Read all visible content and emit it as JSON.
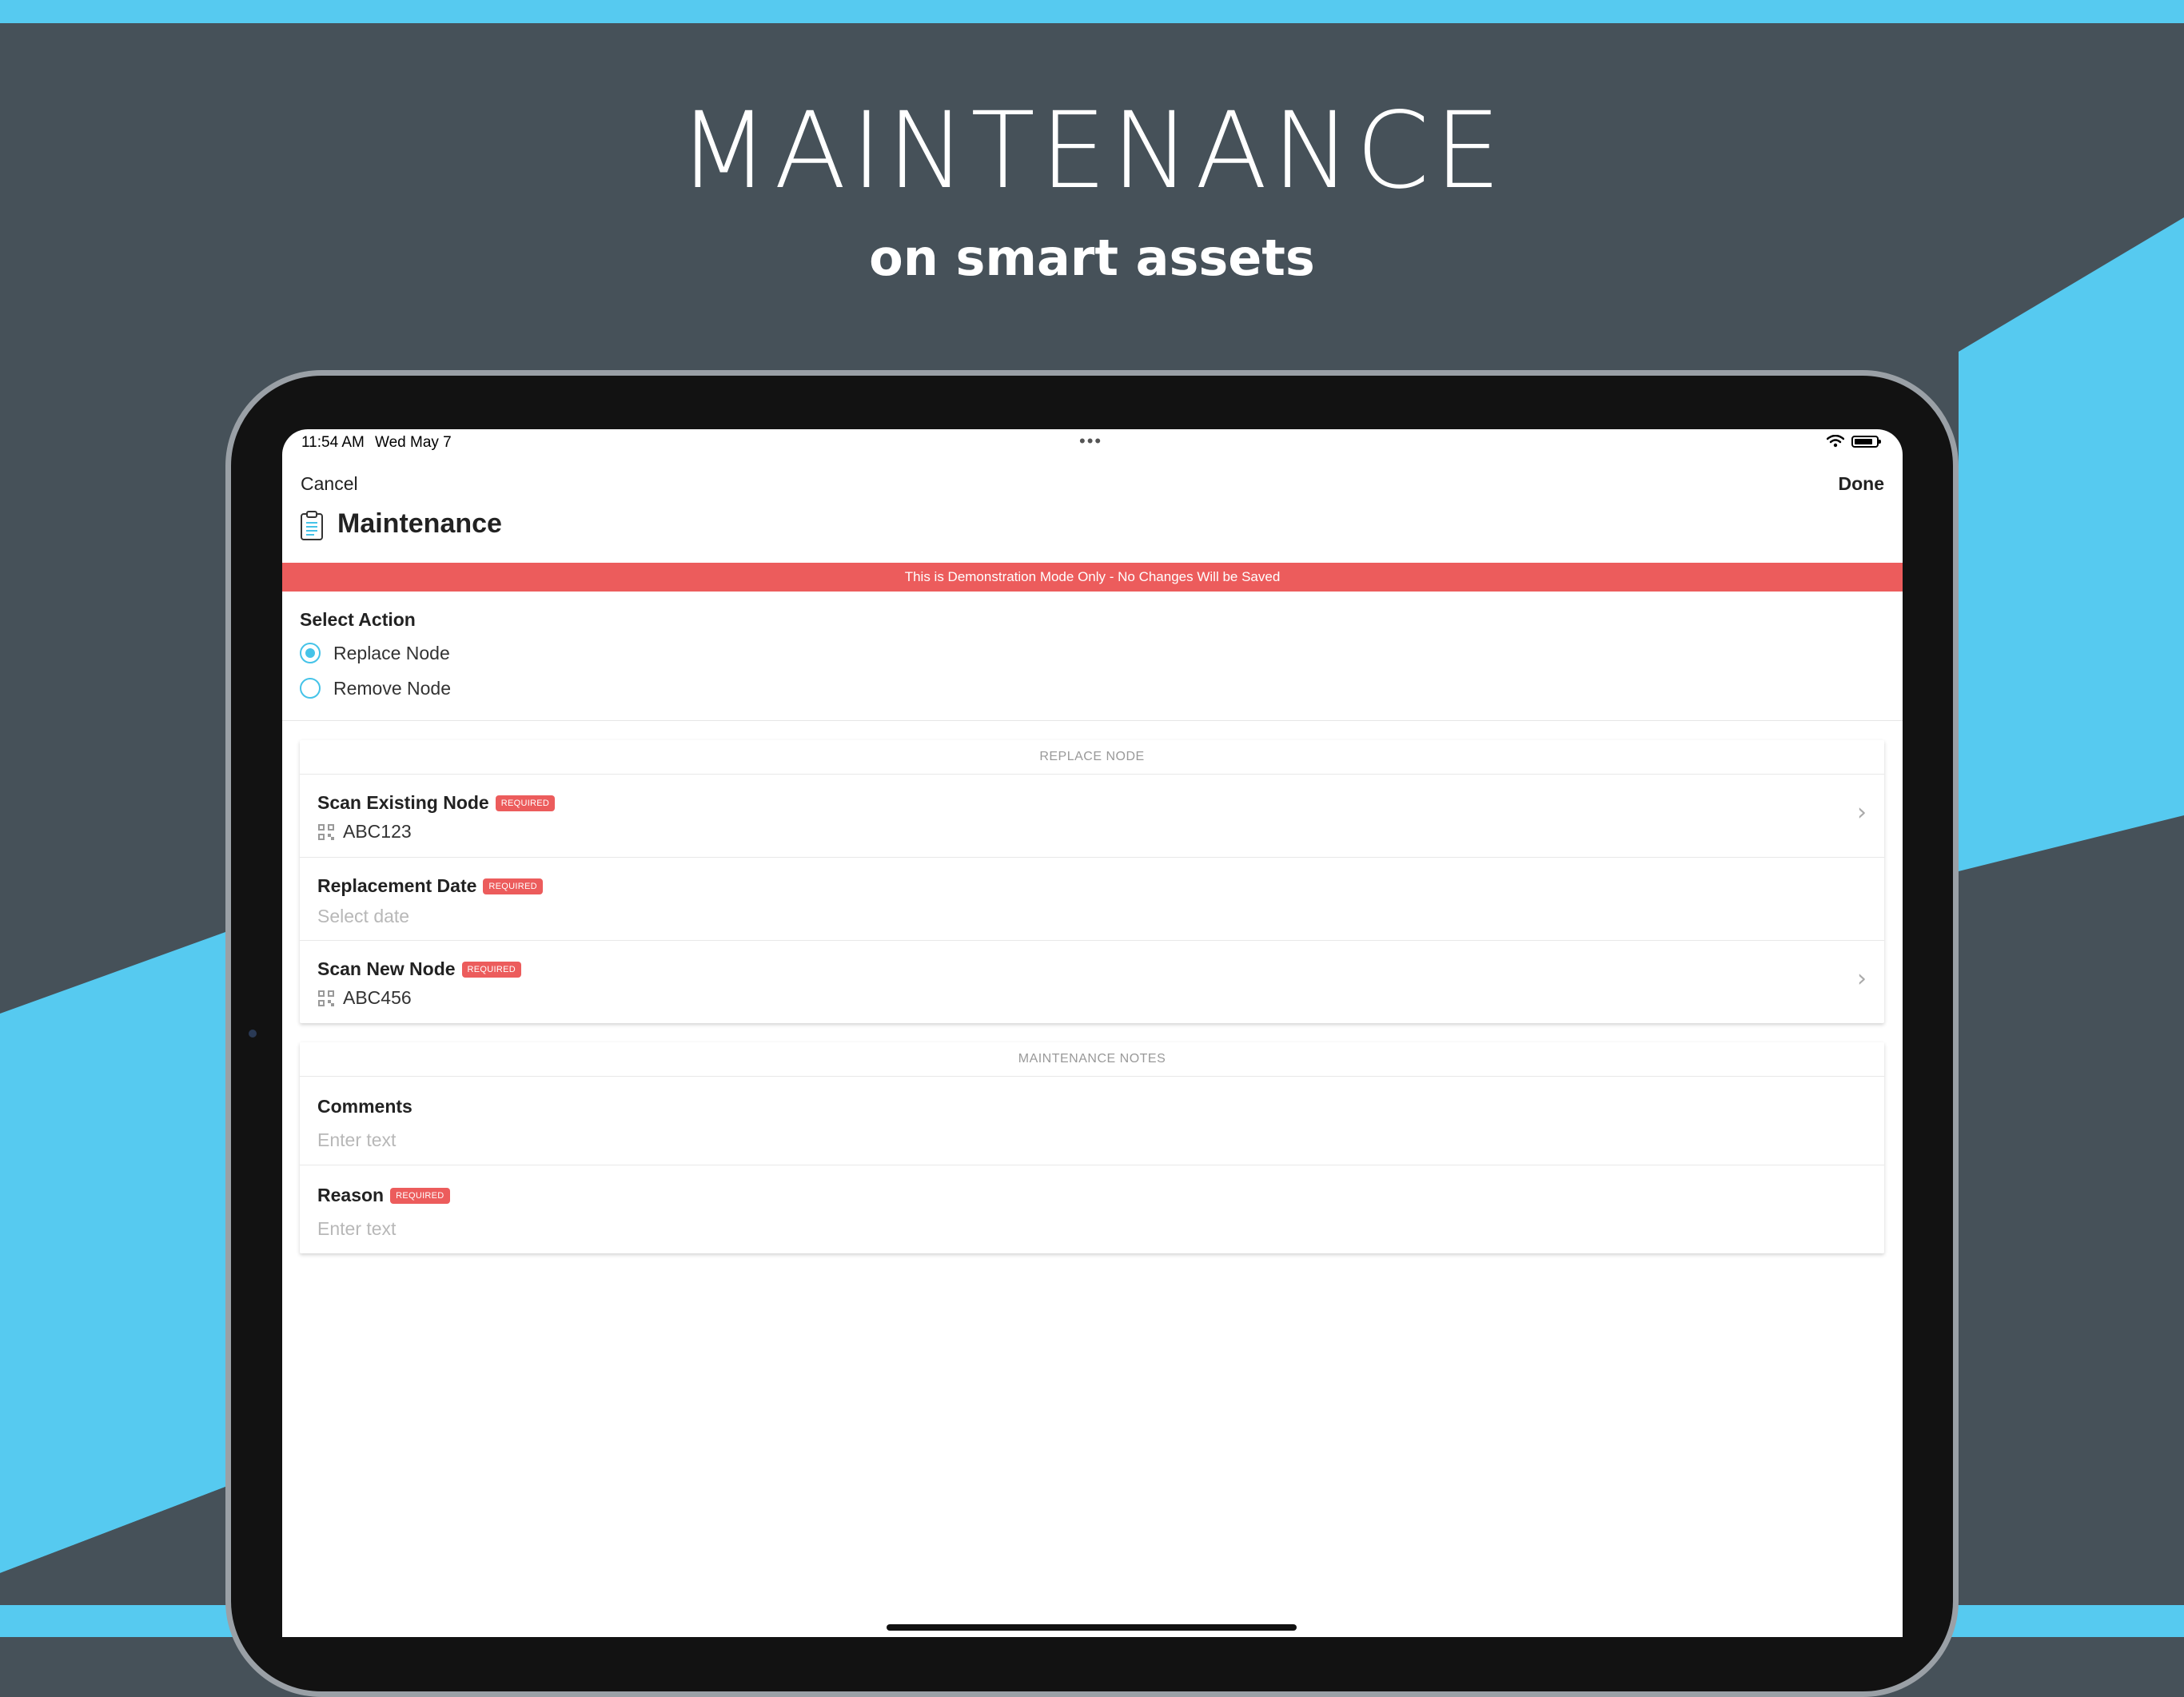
{
  "marketing": {
    "headline": "MAINTENANCE",
    "subline": "on smart assets"
  },
  "colors": {
    "accent": "#56CAF0",
    "background": "#465159",
    "required": "#EC5C5C",
    "radio": "#45C3E8"
  },
  "status_bar": {
    "time": "11:54 AM",
    "date": "Wed May 7",
    "multitask_dots": "•••",
    "wifi_icon": "wifi-icon",
    "battery_icon": "battery-icon"
  },
  "nav": {
    "cancel_label": "Cancel",
    "done_label": "Done",
    "title": "Maintenance",
    "title_icon": "clipboard-icon"
  },
  "demo_banner": "This is Demonstration Mode Only - No Changes Will be Saved",
  "select_action": {
    "label": "Select Action",
    "options": [
      {
        "label": "Replace Node",
        "selected": true
      },
      {
        "label": "Remove Node",
        "selected": false
      }
    ]
  },
  "replace_node_card": {
    "header": "REPLACE NODE",
    "fields": [
      {
        "label": "Scan Existing Node",
        "badge": "REQUIRED",
        "value": "ABC123",
        "icon": "qr-code-icon",
        "chevron": "›"
      },
      {
        "label": "Replacement Date",
        "badge": "REQUIRED",
        "placeholder": "Select date"
      },
      {
        "label": "Scan New Node",
        "badge": "REQUIRED",
        "value": "ABC456",
        "icon": "qr-code-icon",
        "chevron": "›"
      }
    ]
  },
  "notes_card": {
    "header": "MAINTENANCE NOTES",
    "fields": [
      {
        "label": "Comments",
        "placeholder": "Enter text"
      },
      {
        "label": "Reason",
        "badge": "REQUIRED",
        "placeholder": "Enter text"
      }
    ]
  }
}
